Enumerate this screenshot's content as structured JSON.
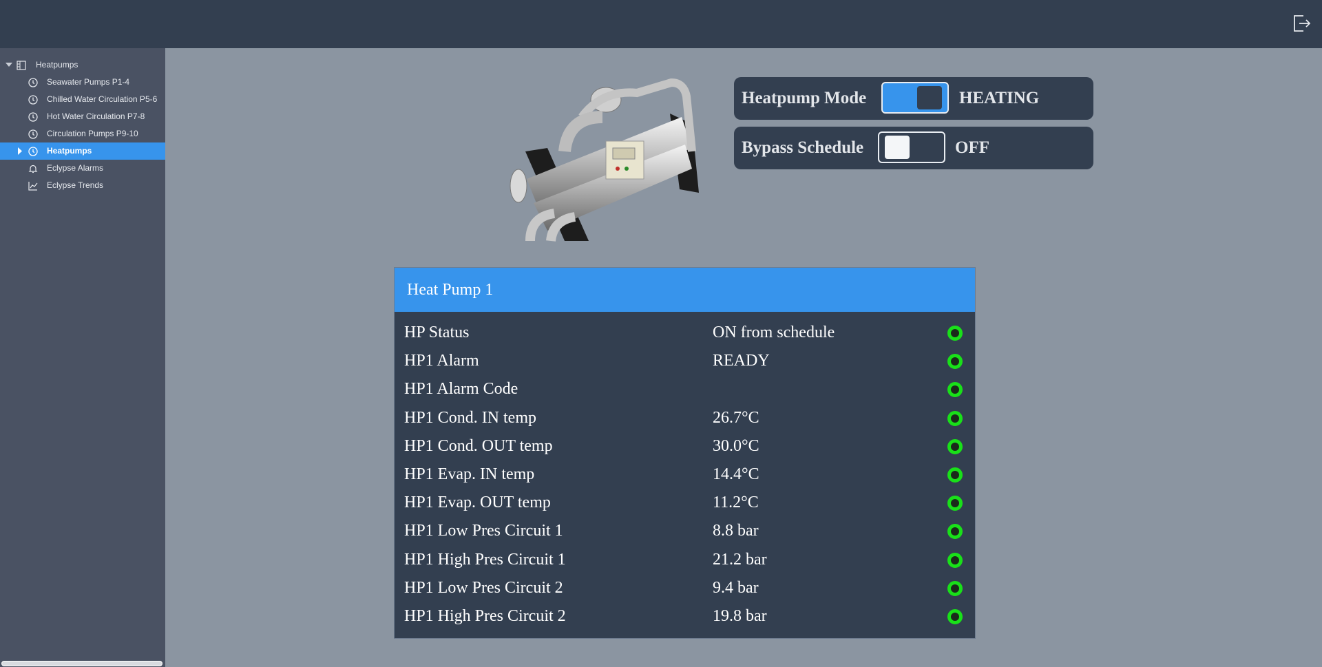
{
  "colors": {
    "topbar": "#333f50",
    "sidebar": "#4a5263",
    "content_bg": "#8b95a1",
    "accent": "#3794ec",
    "panel": "#333f50",
    "status_ok": "#19e019"
  },
  "topbar": {
    "logout_icon": "logout-icon"
  },
  "sidebar": {
    "root": {
      "label": "Heatpumps",
      "icon": "building-icon"
    },
    "items": [
      {
        "label": "Seawater Pumps P1-4",
        "icon": "clock-icon",
        "selected": false
      },
      {
        "label": "Chilled Water Circulation P5-6",
        "icon": "clock-icon",
        "selected": false
      },
      {
        "label": "Hot Water Circulation P7-8",
        "icon": "clock-icon",
        "selected": false
      },
      {
        "label": "Circulation Pumps P9-10",
        "icon": "clock-icon",
        "selected": false
      },
      {
        "label": "Heatpumps",
        "icon": "clock-icon",
        "selected": true
      },
      {
        "label": "Eclypse Alarms",
        "icon": "bell-icon",
        "selected": false
      },
      {
        "label": "Eclypse Trends",
        "icon": "chart-icon",
        "selected": false
      }
    ]
  },
  "controls": {
    "mode": {
      "title": "Heatpump Mode",
      "state": "HEATING",
      "on": true
    },
    "bypass": {
      "title": "Bypass Schedule",
      "state": "OFF",
      "on": false
    }
  },
  "panel": {
    "title": "Heat Pump 1",
    "rows": [
      {
        "name": "HP Status",
        "value": "ON from schedule"
      },
      {
        "name": "HP1 Alarm",
        "value": "READY"
      },
      {
        "name": "HP1 Alarm Code",
        "value": ""
      },
      {
        "name": "HP1 Cond. IN temp",
        "value": "26.7°C"
      },
      {
        "name": "HP1 Cond. OUT temp",
        "value": "30.0°C"
      },
      {
        "name": "HP1 Evap. IN temp",
        "value": "14.4°C"
      },
      {
        "name": "HP1 Evap. OUT temp",
        "value": "11.2°C"
      },
      {
        "name": "HP1 Low Pres Circuit 1",
        "value": "8.8 bar"
      },
      {
        "name": "HP1 High Pres Circuit 1",
        "value": "21.2 bar"
      },
      {
        "name": "HP1 Low Pres Circuit 2",
        "value": "9.4 bar"
      },
      {
        "name": "HP1 High Pres Circuit 2",
        "value": "19.8 bar"
      }
    ]
  }
}
